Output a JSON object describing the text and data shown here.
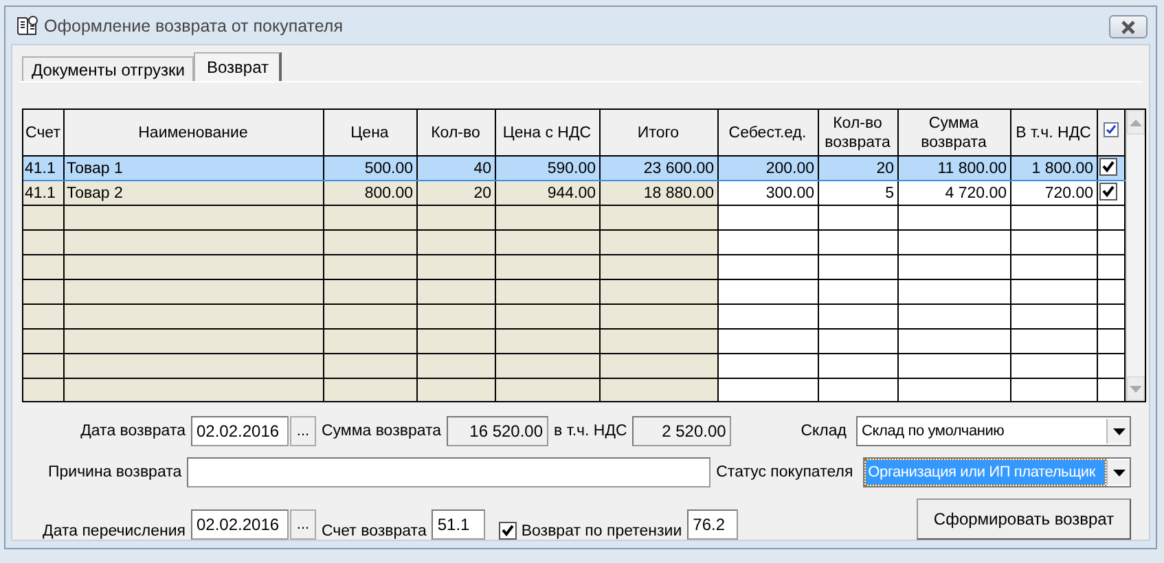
{
  "window": {
    "title": "Оформление возврата от покупателя"
  },
  "tabs": [
    {
      "label": "Документы отгрузки",
      "selected": false
    },
    {
      "label": "Возврат",
      "selected": true
    }
  ],
  "table": {
    "columns": [
      "Счет",
      "Наименование",
      "Цена",
      "Кол-во",
      "Цена с НДС",
      "Итого",
      "Себест.ед.",
      "Кол-во возврата",
      "Сумма возврата",
      "В т.ч. НДС"
    ],
    "check_header": {
      "checked": true
    },
    "rows": [
      {
        "cells": [
          "41.1",
          "Товар 1",
          "500.00",
          "40",
          "590.00",
          "23 600.00",
          "200.00",
          "20",
          "11 800.00",
          "1 800.00"
        ],
        "selected": true,
        "checked": true
      },
      {
        "cells": [
          "41.1",
          "Товар 2",
          "800.00",
          "20",
          "944.00",
          "18 880.00",
          "300.00",
          "5",
          "4 720.00",
          "720.00"
        ],
        "selected": false,
        "checked": true
      }
    ]
  },
  "form": {
    "return_date": {
      "label": "Дата возврата",
      "value": "02.02.2016",
      "button": "..."
    },
    "return_sum": {
      "label": "Сумма возврата",
      "value": "16 520.00"
    },
    "vat": {
      "label": "в т.ч. НДС",
      "value": "2 520.00"
    },
    "warehouse": {
      "label": "Склад",
      "value": "Склад по умолчанию"
    },
    "reason": {
      "label": "Причина возврата"
    },
    "buyer_status": {
      "label": "Статус покупателя",
      "value": "Организация или ИП плательщик",
      "selected": true
    },
    "transfer_date": {
      "label": "Дата перечисления",
      "value": "02.02.2016",
      "button": "..."
    },
    "return_account": {
      "label": "Счет возврата",
      "value": "51.1"
    },
    "claim": {
      "label": "Возврат по претензии",
      "checked": true,
      "value": "76.2"
    },
    "submit": {
      "label": "Сформировать возврат"
    }
  }
}
